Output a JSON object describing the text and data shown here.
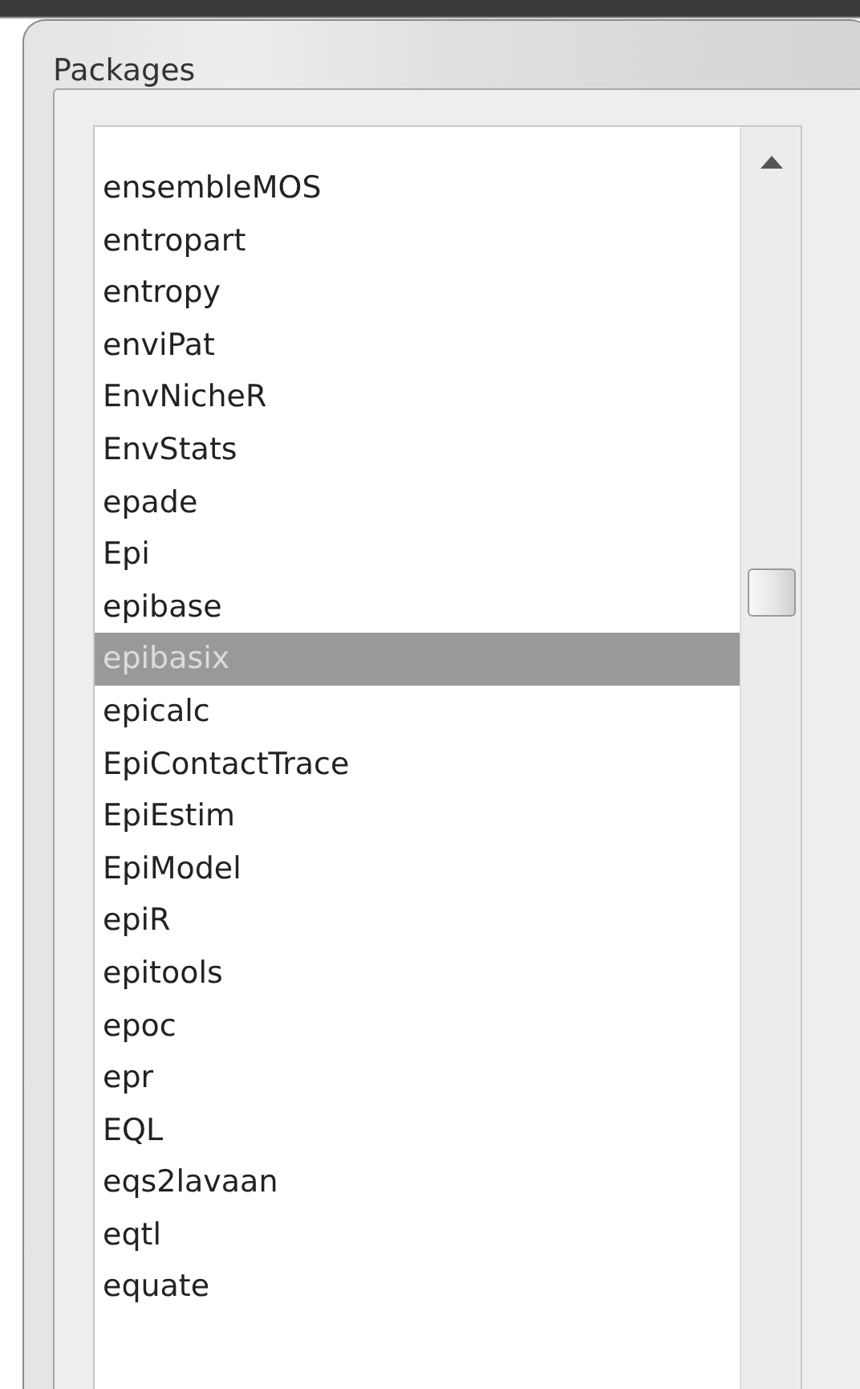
{
  "window": {
    "title": "Packages"
  },
  "packages": {
    "items": [
      {
        "label": "ensembleMOS",
        "selected": false
      },
      {
        "label": "entropart",
        "selected": false
      },
      {
        "label": "entropy",
        "selected": false
      },
      {
        "label": "enviPat",
        "selected": false
      },
      {
        "label": "EnvNicheR",
        "selected": false
      },
      {
        "label": "EnvStats",
        "selected": false
      },
      {
        "label": "epade",
        "selected": false
      },
      {
        "label": "Epi",
        "selected": false
      },
      {
        "label": "epibase",
        "selected": false
      },
      {
        "label": "epibasix",
        "selected": true
      },
      {
        "label": "epicalc",
        "selected": false
      },
      {
        "label": "EpiContactTrace",
        "selected": false
      },
      {
        "label": "EpiEstim",
        "selected": false
      },
      {
        "label": "EpiModel",
        "selected": false
      },
      {
        "label": "epiR",
        "selected": false
      },
      {
        "label": "epitools",
        "selected": false
      },
      {
        "label": "epoc",
        "selected": false
      },
      {
        "label": "epr",
        "selected": false
      },
      {
        "label": "EQL",
        "selected": false
      },
      {
        "label": "eqs2lavaan",
        "selected": false
      },
      {
        "label": "eqtl",
        "selected": false
      },
      {
        "label": "equate",
        "selected": false
      }
    ]
  }
}
